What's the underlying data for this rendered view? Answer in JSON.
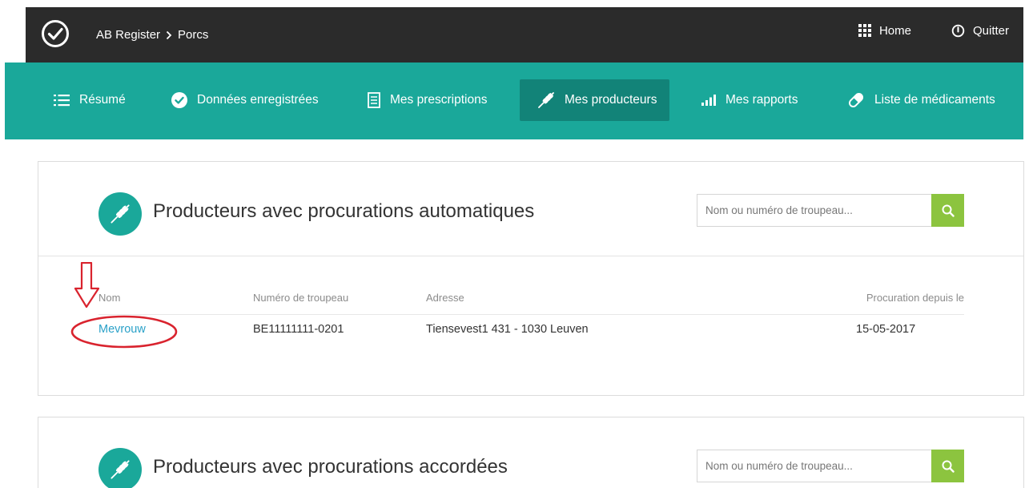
{
  "topbar": {
    "breadcrumb": [
      "AB Register",
      "Porcs"
    ],
    "home_label": "Home",
    "quit_label": "Quitter"
  },
  "nav": {
    "items": [
      {
        "label": "Résumé",
        "icon": "list-icon"
      },
      {
        "label": "Données enregistrées",
        "icon": "check-circle-icon"
      },
      {
        "label": "Mes prescriptions",
        "icon": "document-icon"
      },
      {
        "label": "Mes producteurs",
        "icon": "wheat-icon",
        "active": true
      },
      {
        "label": "Mes rapports",
        "icon": "bar-chart-icon"
      },
      {
        "label": "Liste de médicaments",
        "icon": "pill-icon"
      }
    ]
  },
  "automatic": {
    "title": "Producteurs avec procurations automatiques",
    "search_placeholder": "Nom ou numéro de troupeau...",
    "columns": [
      "Nom",
      "Numéro de troupeau",
      "Adresse",
      "Procuration depuis le"
    ],
    "rows": [
      {
        "nom": "Mevrouw",
        "numero": "BE11111111-0201",
        "adresse": "Tiensevest1 431 - 1030 Leuven",
        "depuis": "15-05-2017"
      }
    ]
  },
  "granted": {
    "title": "Producteurs avec procurations accordées",
    "search_placeholder": "Nom ou numéro de troupeau..."
  },
  "colors": {
    "topbar": "#2b2b2b",
    "navbar": "#1aa89a",
    "nav_active": "#128378",
    "search_button": "#8cc43f",
    "link": "#2aa1c8",
    "annotation": "#d9232e"
  }
}
